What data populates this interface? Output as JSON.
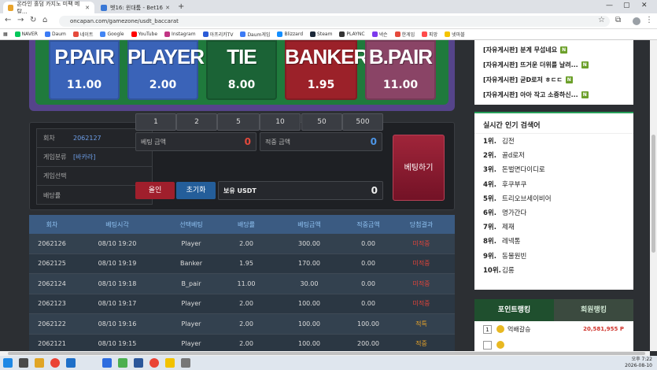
{
  "browser": {
    "tabs": [
      {
        "title": "온라인 홀덤 카지노 미팩 메탈...",
        "fav_color": "#e8a32b"
      },
      {
        "title": "벳16: 윈대툼 - Bet16",
        "fav_color": "#3a78d6"
      }
    ],
    "url": "oncapan.com/gamezone/usdt_baccarat",
    "bookmarks": [
      {
        "label": "NAVER",
        "color": "#03c75a"
      },
      {
        "label": "Daum",
        "color": "#3c7bf5"
      },
      {
        "label": "네이트",
        "color": "#e54a3c"
      },
      {
        "label": "Google",
        "color": "#4285f4"
      },
      {
        "label": "YouTube",
        "color": "#ff0000"
      },
      {
        "label": "Instagram",
        "color": "#c13584"
      },
      {
        "label": "아프리카TV",
        "color": "#2a5bd7"
      },
      {
        "label": "Daum게임",
        "color": "#3c7bf5"
      },
      {
        "label": "Blizzard",
        "color": "#148eff"
      },
      {
        "label": "Steam",
        "color": "#1b2838"
      },
      {
        "label": "PLAYNC",
        "color": "#333333"
      },
      {
        "label": "넥슨",
        "color": "#7c3aed"
      },
      {
        "label": "한게임",
        "color": "#e54a3c"
      },
      {
        "label": "피망",
        "color": "#ff4b4b"
      },
      {
        "label": "넷마블",
        "color": "#f5c400"
      }
    ]
  },
  "cards": [
    {
      "name": "P.PAIR",
      "odds": "11.00",
      "color": "#3a63b8"
    },
    {
      "name": "PLAYER",
      "odds": "2.00",
      "color": "#3a63b8"
    },
    {
      "name": "TIE",
      "odds": "8.00",
      "color": "#1b6336"
    },
    {
      "name": "BANKER",
      "odds": "1.95",
      "color": "#9b2129"
    },
    {
      "name": "B.PAIR",
      "odds": "11.00",
      "color": "#8a4466"
    }
  ],
  "info": {
    "round_label": "회차",
    "round_value": "2062127",
    "type_label": "게임분류",
    "type_value": "[바카라]",
    "pick_label": "게임선택",
    "pick_value": "",
    "odds_label": "배당률",
    "odds_value": ""
  },
  "bet": {
    "amount_label": "베팅 금액",
    "amount_value": "0",
    "win_label": "적중 금액",
    "win_value": "0",
    "chips": [
      "1",
      "2",
      "5",
      "10",
      "50",
      "500"
    ],
    "allin_label": "올인",
    "reset_label": "초기화",
    "holding_label": "보유 USDT",
    "holding_value": "0",
    "bet_button": "베팅하기"
  },
  "history": {
    "headers": [
      "회차",
      "베팅시각",
      "선택베팅",
      "배당률",
      "베팅금액",
      "적중금액",
      "당첨결과"
    ],
    "rows": [
      [
        "2062126",
        "08/10 19:20",
        "Player",
        "2.00",
        "300.00",
        "0.00",
        "미적중"
      ],
      [
        "2062125",
        "08/10 19:19",
        "Banker",
        "1.95",
        "170.00",
        "0.00",
        "미적중"
      ],
      [
        "2062124",
        "08/10 19:18",
        "B_pair",
        "11.00",
        "30.00",
        "0.00",
        "미적중"
      ],
      [
        "2062123",
        "08/10 19:17",
        "Player",
        "2.00",
        "100.00",
        "0.00",
        "미적중"
      ],
      [
        "2062122",
        "08/10 19:16",
        "Player",
        "2.00",
        "100.00",
        "100.00",
        "적특"
      ],
      [
        "2062121",
        "08/10 19:15",
        "Player",
        "2.00",
        "100.00",
        "200.00",
        "적중"
      ]
    ]
  },
  "posts": [
    {
      "cat": "[자유게시판]",
      "title": "분계 무섭네요",
      "badge": "N"
    },
    {
      "cat": "[자유게시판]",
      "title": "뜨거운 더위를 날려...",
      "badge": "N"
    },
    {
      "cat": "[자유게시판]",
      "title": "굳D로저 ㅎㄷㄷ",
      "badge": "N"
    },
    {
      "cat": "[자유게시판]",
      "title": "아아 작고 소중하신...",
      "badge": "N"
    }
  ],
  "popular": {
    "title": "실시간 인기 검색어",
    "items": [
      {
        "rank": "1위.",
        "word": "김전"
      },
      {
        "rank": "2위.",
        "word": "골d로저"
      },
      {
        "rank": "3위.",
        "word": "돈벌면다이디로"
      },
      {
        "rank": "4위.",
        "word": "후쿠부쿠"
      },
      {
        "rank": "5위.",
        "word": "트리오브세이비어"
      },
      {
        "rank": "6위.",
        "word": "명가간다"
      },
      {
        "rank": "7위.",
        "word": "제재"
      },
      {
        "rank": "8위.",
        "word": "레넥통"
      },
      {
        "rank": "9위.",
        "word": "동물원빈"
      },
      {
        "rank": "10위.",
        "word": "김롱"
      }
    ]
  },
  "ranking": {
    "tab_point": "포인트랭킹",
    "tab_member": "회원랭킹",
    "rows": [
      {
        "pos": "1",
        "name": "억배갈승",
        "points": "20,581,955 P"
      },
      {
        "pos": "",
        "name": "",
        "points": ""
      }
    ]
  },
  "clock": {
    "time": "오후 7:22",
    "date": "2026-08-10"
  }
}
